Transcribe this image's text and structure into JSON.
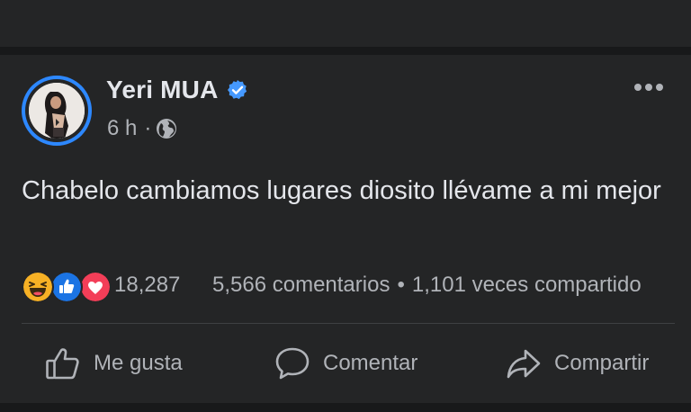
{
  "post": {
    "author": "Yeri MUA",
    "time": "6 h",
    "meta_separator": "·",
    "text": "Chabelo cambiamos lugares diosito llévame a mi mejor"
  },
  "reactions": {
    "types": [
      "haha-icon",
      "like-icon",
      "love-icon"
    ],
    "count": "18,287",
    "comments": "5,566 comentarios",
    "stats_separator": "•",
    "shares": "1,101 veces compartido"
  },
  "actions": {
    "like_label": "Me gusta",
    "comment_label": "Comentar",
    "share_label": "Compartir"
  },
  "colors": {
    "background": "#18191a",
    "card": "#242526",
    "primary_text": "#e4e6eb",
    "secondary_text": "#b0b3b8",
    "accent_blue": "#2d88ff",
    "love_red": "#f33e58",
    "haha_yellow": "#f7b125"
  }
}
